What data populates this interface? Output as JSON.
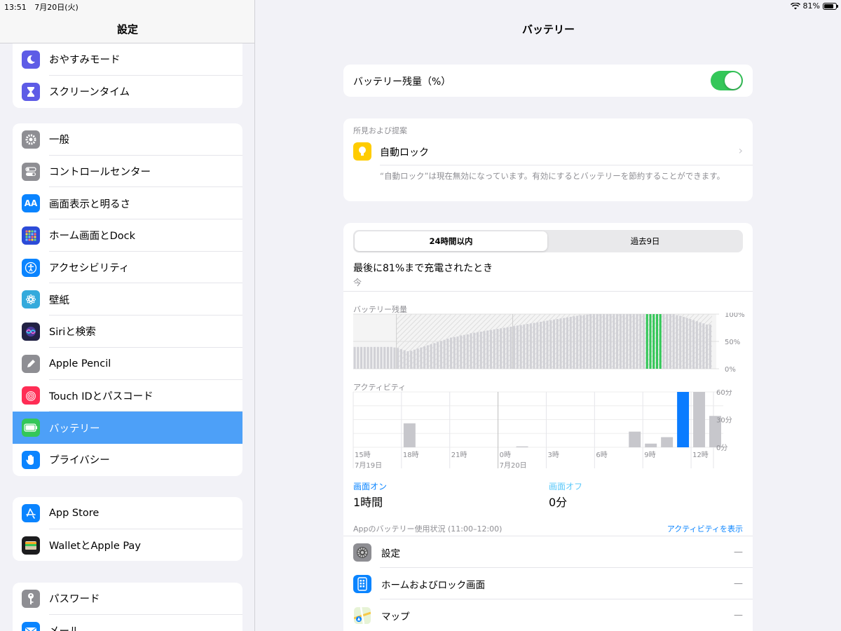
{
  "status": {
    "time": "13:51",
    "date": "7月20日(火)",
    "battery": "81%"
  },
  "sidebar": {
    "title": "設定",
    "groups": [
      [
        {
          "label": "おやすみモード",
          "color": "#5e5ce6",
          "icon": "moon-icon"
        },
        {
          "label": "スクリーンタイム",
          "color": "#5e5ce6",
          "icon": "hourglass-icon"
        }
      ],
      [
        {
          "label": "一般",
          "color": "#8e8e93",
          "icon": "gear-icon"
        },
        {
          "label": "コントロールセンター",
          "color": "#8e8e93",
          "icon": "switches-icon"
        },
        {
          "label": "画面表示と明るさ",
          "color": "#0a84ff",
          "icon": "text-size-icon"
        },
        {
          "label": "ホーム画面とDock",
          "color": "#2c4bd8",
          "icon": "grid-icon"
        },
        {
          "label": "アクセシビリティ",
          "color": "#0a84ff",
          "icon": "accessibility-icon"
        },
        {
          "label": "壁紙",
          "color": "#34aadc",
          "icon": "flower-icon"
        },
        {
          "label": "Siriと検索",
          "color": "#222244",
          "icon": "siri-icon"
        },
        {
          "label": "Apple Pencil",
          "color": "#8e8e93",
          "icon": "pencil-icon"
        },
        {
          "label": "Touch IDとパスコード",
          "color": "#ff2d55",
          "icon": "fingerprint-icon"
        },
        {
          "label": "バッテリー",
          "color": "#34c759",
          "icon": "battery-icon",
          "selected": true
        },
        {
          "label": "プライバシー",
          "color": "#0a84ff",
          "icon": "hand-icon"
        }
      ],
      [
        {
          "label": "App Store",
          "color": "#0a84ff",
          "icon": "appstore-icon"
        },
        {
          "label": "WalletとApple Pay",
          "color": "#1c1c1e",
          "icon": "wallet-icon"
        }
      ],
      [
        {
          "label": "パスワード",
          "color": "#8e8e93",
          "icon": "key-icon"
        },
        {
          "label": "メール",
          "color": "#0a84ff",
          "icon": "mail-icon"
        }
      ]
    ]
  },
  "main": {
    "title": "バッテリー",
    "battery_percentage_label": "バッテリー残量（%）",
    "battery_percentage_on": true,
    "insights": {
      "header": "所見および提案",
      "item_label": "自動ロック",
      "description": "“自動ロック”は現在無効になっています。有効にするとバッテリーを節約することができます。"
    },
    "segments": [
      "24時間以内",
      "過去9日"
    ],
    "last_charged_label": "最後に81%まで充電されたとき",
    "last_charged_time": "今",
    "level_title": "バッテリー残量",
    "activity_title": "アクティビティ",
    "screen_on_label": "画面オン",
    "screen_on_value": "1時間",
    "screen_off_label": "画面オフ",
    "screen_off_value": "0分",
    "app_usage_label": "Appのバッテリー使用状況 (11:00–12:00)",
    "show_activity": "アクティビティを表示",
    "apps": [
      {
        "name": "設定",
        "value": "—",
        "icon": "settings-app-icon",
        "color": "#8e8e93"
      },
      {
        "name": "ホームおよびロック画面",
        "value": "—",
        "icon": "home-lock-icon",
        "color": "#0a84ff"
      },
      {
        "name": "マップ",
        "value": "—",
        "icon": "maps-icon",
        "color": "#5ac85a"
      }
    ]
  },
  "chart_data": [
    {
      "type": "bar",
      "title": "バッテリー残量",
      "ylim": [
        0,
        100
      ],
      "y_ticks": [
        "100%",
        "50%",
        "0%"
      ],
      "values": [
        40,
        40,
        40,
        40,
        40,
        40,
        40,
        40,
        40,
        40,
        40,
        40,
        39,
        38,
        36,
        34,
        32,
        33,
        35,
        37,
        39,
        41,
        43,
        45,
        47,
        49,
        51,
        53,
        55,
        57,
        58,
        59,
        61,
        62,
        63,
        65,
        66,
        67,
        68,
        69,
        70,
        71,
        72,
        73,
        74,
        75,
        76,
        77,
        78,
        79,
        80,
        81,
        82,
        83,
        84,
        85,
        86,
        87,
        88,
        89,
        90,
        91,
        92,
        93,
        94,
        95,
        96,
        97,
        98,
        98,
        99,
        100,
        100,
        100,
        100,
        100,
        100,
        100,
        100,
        100,
        100,
        100,
        100,
        100,
        100,
        100,
        100,
        100,
        100,
        100,
        100,
        100,
        100,
        100,
        100,
        100,
        100,
        98,
        97,
        95,
        93,
        91,
        89,
        87,
        85,
        83,
        81,
        81
      ],
      "charging_range": [
        88,
        92
      ]
    },
    {
      "type": "bar",
      "title": "アクティビティ",
      "categories": [
        "15時",
        "18時",
        "21時",
        "0時",
        "3時",
        "6時",
        "9時",
        "12時"
      ],
      "date_labels": [
        "7月19日",
        "7月20日"
      ],
      "y_ticks": [
        "60分",
        "30分",
        "0分"
      ],
      "ylim": [
        0,
        60
      ],
      "values": [
        0,
        0,
        0,
        26,
        0,
        0,
        0,
        0,
        0,
        0,
        1,
        0,
        0,
        0,
        0,
        0,
        0,
        17,
        4,
        11,
        60,
        60,
        34
      ],
      "highlight_index": 20
    }
  ]
}
